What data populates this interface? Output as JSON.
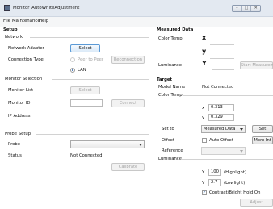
{
  "window": {
    "title": "Monitor_AutoWhiteAdjustment",
    "buttons": [
      "–",
      "□",
      "✕"
    ]
  },
  "menu": [
    "File",
    "Maintenance",
    "Help"
  ],
  "setup": {
    "heading": "Setup",
    "network": {
      "label": "Network",
      "adapter_label": "Network Adapter",
      "select_button": "Select",
      "connection_type_label": "Connection Type",
      "peer_option": "Peer to Peer",
      "lan_option": "LAN",
      "reconnection_button": "Reconnection"
    },
    "monitor_selection": {
      "label": "Monitor Selection",
      "monitor_list_label": "Monitor List",
      "select_button": "Select",
      "monitor_id_label": "Monitor ID",
      "monitor_id_value": "",
      "connect_button": "Connect",
      "ip_address_label": "IP Address"
    },
    "probe_setup": {
      "label": "Probe Setup",
      "probe_label": "Probe",
      "probe_value": "",
      "status_label": "Status",
      "status_value": "Not Connected",
      "calibrate_button": "Calibrate"
    }
  },
  "measured": {
    "heading": "Measured Data",
    "color_temp_label": "Color Temp.",
    "x_symbol": "x",
    "y_symbol": "y",
    "luminance_label": "Luminance",
    "Y_symbol": "Y",
    "start_button": "Start Measurem"
  },
  "target": {
    "heading": "Target",
    "model_name_label": "Model Name",
    "model_name_value": "Not Connected",
    "color_temp_label": "Color Temp.",
    "x_label": "x",
    "x_value": "0.313",
    "y_label": "y",
    "y_value": "0.329",
    "set_to_label": "Set to",
    "set_to_value": "Measured Data",
    "set_button": "Set",
    "offset_label": "Offset",
    "auto_offset_label": "Auto Offset",
    "more_info_button": "More Inf",
    "reference_label": "Reference",
    "reference_value": "",
    "luminance_label": "Luminance",
    "Y_label": "Y",
    "highlight_value": "100",
    "highlight_label": "(Highlight)",
    "lowlight_value": "2.7",
    "lowlight_label": "(Lowlight)",
    "contrast_label": "Contrast/Bright Hold On",
    "contrast_checked": "✓",
    "adjust_button": "Adjust"
  }
}
